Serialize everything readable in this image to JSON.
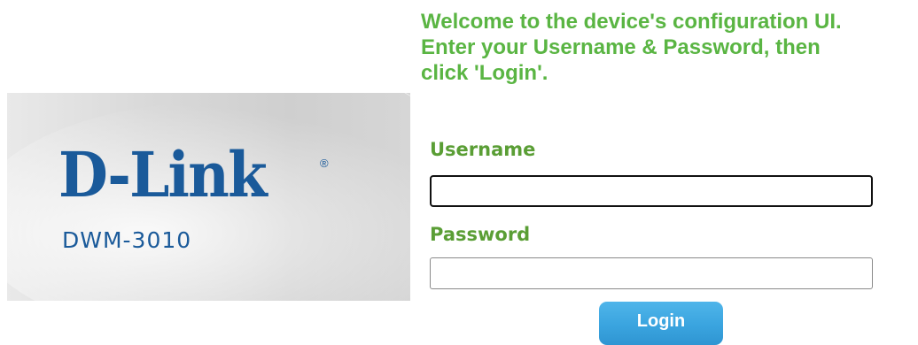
{
  "brand": {
    "logo_text": "D-Link",
    "registered_mark": "®",
    "model": "DWM-3010",
    "logo_color": "#1a5a9a"
  },
  "login": {
    "welcome_line1": "Welcome to the device's configuration UI.",
    "welcome_line2": "Enter your Username & Password, then",
    "welcome_line3": "click 'Login'.",
    "username_label": "Username",
    "username_value": "",
    "password_label": "Password",
    "password_value": "",
    "button_label": "Login",
    "accent_color": "#5ab543",
    "button_color": "#3aa4df"
  }
}
